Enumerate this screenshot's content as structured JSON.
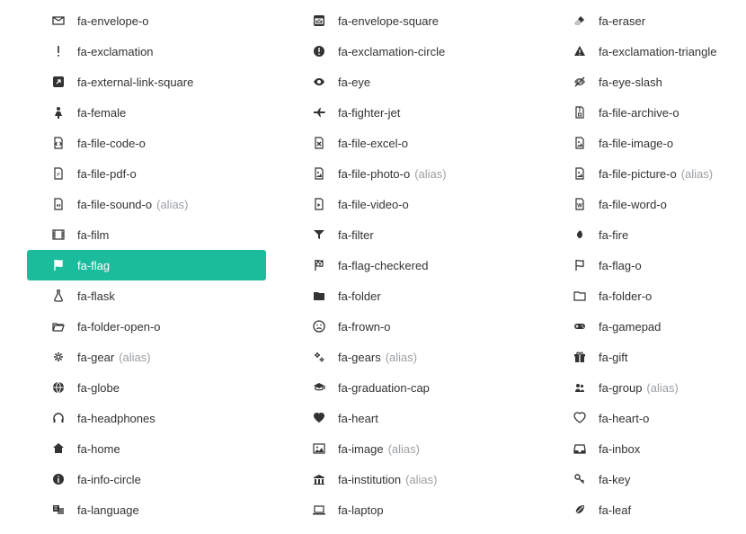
{
  "alias_suffix": "(alias)",
  "selected": "fa-flag",
  "icons": {
    "col1": [
      {
        "name": "fa-envelope-o",
        "alias": false
      },
      {
        "name": "fa-exclamation",
        "alias": false
      },
      {
        "name": "fa-external-link-square",
        "alias": false
      },
      {
        "name": "fa-female",
        "alias": false
      },
      {
        "name": "fa-file-code-o",
        "alias": false
      },
      {
        "name": "fa-file-pdf-o",
        "alias": false
      },
      {
        "name": "fa-file-sound-o",
        "alias": true
      },
      {
        "name": "fa-film",
        "alias": false
      },
      {
        "name": "fa-flag",
        "alias": false
      },
      {
        "name": "fa-flask",
        "alias": false
      },
      {
        "name": "fa-folder-open-o",
        "alias": false
      },
      {
        "name": "fa-gear",
        "alias": true
      },
      {
        "name": "fa-globe",
        "alias": false
      },
      {
        "name": "fa-headphones",
        "alias": false
      },
      {
        "name": "fa-home",
        "alias": false
      },
      {
        "name": "fa-info-circle",
        "alias": false
      },
      {
        "name": "fa-language",
        "alias": false
      }
    ],
    "col2": [
      {
        "name": "fa-envelope-square",
        "alias": false
      },
      {
        "name": "fa-exclamation-circle",
        "alias": false
      },
      {
        "name": "fa-eye",
        "alias": false
      },
      {
        "name": "fa-fighter-jet",
        "alias": false
      },
      {
        "name": "fa-file-excel-o",
        "alias": false
      },
      {
        "name": "fa-file-photo-o",
        "alias": true
      },
      {
        "name": "fa-file-video-o",
        "alias": false
      },
      {
        "name": "fa-filter",
        "alias": false
      },
      {
        "name": "fa-flag-checkered",
        "alias": false
      },
      {
        "name": "fa-folder",
        "alias": false
      },
      {
        "name": "fa-frown-o",
        "alias": false
      },
      {
        "name": "fa-gears",
        "alias": true
      },
      {
        "name": "fa-graduation-cap",
        "alias": false
      },
      {
        "name": "fa-heart",
        "alias": false
      },
      {
        "name": "fa-image",
        "alias": true
      },
      {
        "name": "fa-institution",
        "alias": true
      },
      {
        "name": "fa-laptop",
        "alias": false
      }
    ],
    "col3": [
      {
        "name": "fa-eraser",
        "alias": false
      },
      {
        "name": "fa-exclamation-triangle",
        "alias": false
      },
      {
        "name": "fa-eye-slash",
        "alias": false
      },
      {
        "name": "fa-file-archive-o",
        "alias": false
      },
      {
        "name": "fa-file-image-o",
        "alias": false
      },
      {
        "name": "fa-file-picture-o",
        "alias": true
      },
      {
        "name": "fa-file-word-o",
        "alias": false
      },
      {
        "name": "fa-fire",
        "alias": false
      },
      {
        "name": "fa-flag-o",
        "alias": false
      },
      {
        "name": "fa-folder-o",
        "alias": false
      },
      {
        "name": "fa-gamepad",
        "alias": false
      },
      {
        "name": "fa-gift",
        "alias": false
      },
      {
        "name": "fa-group",
        "alias": true
      },
      {
        "name": "fa-heart-o",
        "alias": false
      },
      {
        "name": "fa-inbox",
        "alias": false
      },
      {
        "name": "fa-key",
        "alias": false
      },
      {
        "name": "fa-leaf",
        "alias": false
      }
    ]
  }
}
